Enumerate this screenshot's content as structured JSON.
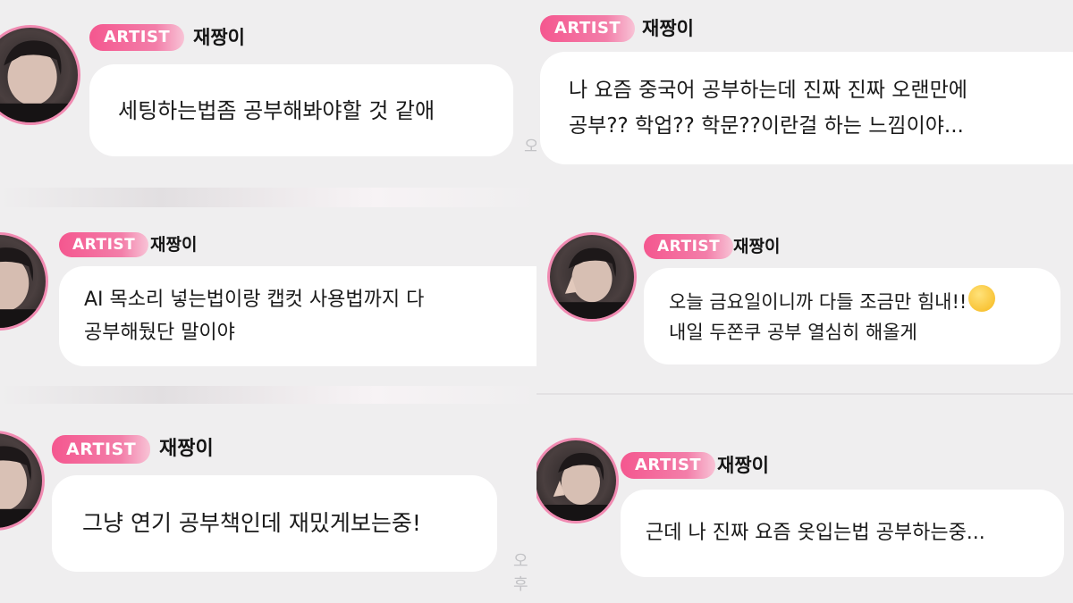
{
  "badge_label": "ARTIST",
  "artist_name": "재짱이",
  "time_fragment": "오",
  "time_fragment_2": "오후",
  "messages": [
    {
      "text": "세팅하는법좀 공부해봐야할 것 같애"
    },
    {
      "text": "나 요즘 중국어 공부하는데 진짜 진짜 오랜만에\n공부?? 학업?? 학문??이란걸 하는 느낌이야..."
    },
    {
      "text": "AI 목소리 넣는법이랑 캡컷 사용법까지 다\n공부해뒀단 말이야"
    },
    {
      "text": "오늘 금요일이니까 다들 조금만 힘내!!"
    },
    {
      "text": "내일 두쫀쿠 공부 열심히 해올게"
    },
    {
      "text": "그냥 연기 공부책인데 재밌게보는중!"
    },
    {
      "text": "근데 나 진짜 요즘 옷입는법 공부하는중..."
    }
  ],
  "colors": {
    "badge": "#f4578f",
    "avatar_ring": "#f08ab1",
    "background": "#efeeef"
  },
  "icons": {
    "emoji": "smiling-face-emoji"
  }
}
